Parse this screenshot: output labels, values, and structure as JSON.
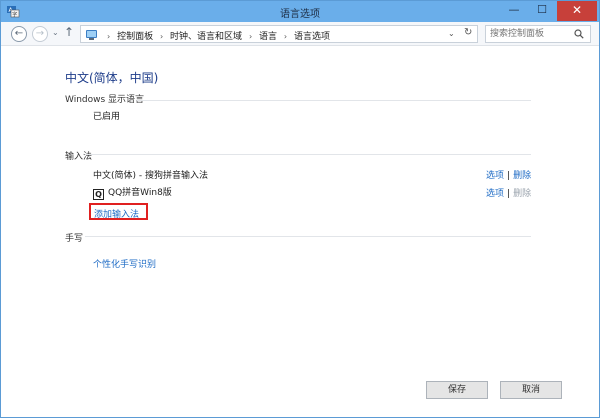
{
  "window": {
    "title": "语言选项",
    "min_glyph": "—",
    "max_glyph": "☐",
    "close_glyph": "✕"
  },
  "toolbar": {
    "back_glyph": "←",
    "forward_glyph": "→",
    "recent_glyph": "⌄",
    "up_glyph": "↑",
    "breadcrumbs": [
      "控制面板",
      "时钟、语言和区域",
      "语言",
      "语言选项"
    ],
    "breadcrumb_sep": "›",
    "dropdown_glyph": "⌄",
    "refresh_glyph": "↻",
    "search_placeholder": "搜索控制面板"
  },
  "page": {
    "title": "中文(简体，中国)",
    "windows_display_section": "Windows 显示语言",
    "display_status": "已启用",
    "ime_section": "输入法",
    "ime_items": [
      {
        "name": "中文(简体) - 搜狗拼音输入法",
        "options": "选项",
        "sep": "|",
        "delete": "删除",
        "delete_enabled": true
      },
      {
        "icon_letter": "Q",
        "name": "QQ拼音Win8版",
        "options": "选项",
        "sep": "|",
        "delete": "删除",
        "delete_enabled": false
      }
    ],
    "add_ime": "添加输入法",
    "handwriting_section": "手写",
    "handwriting_link": "个性化手写识别"
  },
  "footer": {
    "save": "保存",
    "cancel": "取消"
  },
  "colors": {
    "accent_title": "#1e3d8a",
    "link": "#1e6bc5",
    "highlight_box": "#e02020",
    "titlebar": "#6aaeea"
  }
}
